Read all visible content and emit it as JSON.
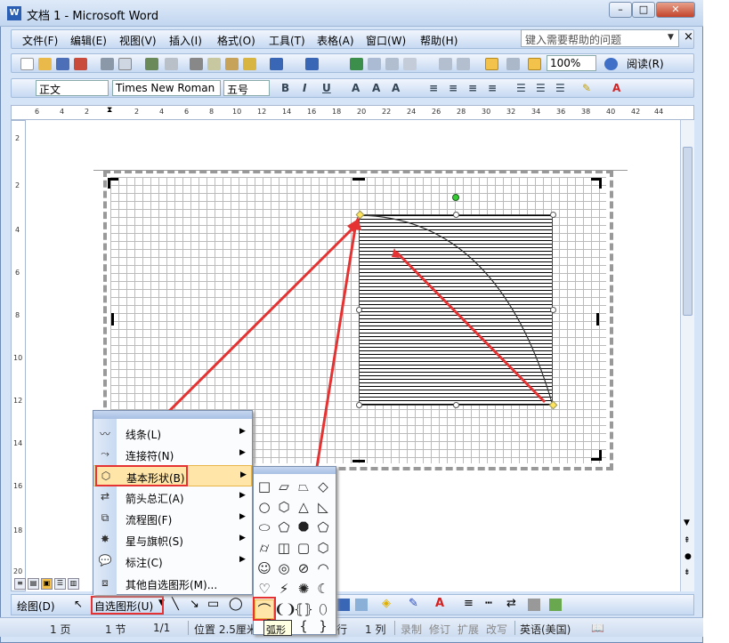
{
  "window": {
    "title": "文档 1 - Microsoft Word",
    "min_label": "–",
    "max_label": "□",
    "close_label": "✕",
    "app_icon": "W"
  },
  "menu": {
    "items": [
      "文件(F)",
      "编辑(E)",
      "视图(V)",
      "插入(I)",
      "格式(O)",
      "工具(T)",
      "表格(A)",
      "窗口(W)",
      "帮助(H)"
    ],
    "help_placeholder": "键入需要帮助的问题",
    "close_doc": "×"
  },
  "toolbar": {
    "zoom": "100%",
    "read": "阅读(R)"
  },
  "format": {
    "style": "正文",
    "font": "Times New Roman",
    "size": "五号"
  },
  "ruler": {
    "h_ticks": [
      "6",
      "4",
      "2",
      "2",
      "4",
      "6",
      "8",
      "10",
      "12",
      "14",
      "16",
      "18",
      "20",
      "22",
      "24",
      "26",
      "28",
      "30",
      "32",
      "34",
      "36",
      "38",
      "40",
      "42",
      "44"
    ],
    "v_ticks": [
      "2",
      "2",
      "4",
      "6",
      "8",
      "10",
      "12",
      "14",
      "16",
      "18",
      "20"
    ]
  },
  "autoshape_menu": {
    "items": [
      {
        "label": "线条(L)",
        "icon": "line-icon",
        "arrow": true
      },
      {
        "label": "连接符(N)",
        "icon": "connector-icon",
        "arrow": true
      },
      {
        "label": "基本形状(B)",
        "icon": "basic-shapes-icon",
        "arrow": true,
        "highlight": true
      },
      {
        "label": "箭头总汇(A)",
        "icon": "block-arrows-icon",
        "arrow": true
      },
      {
        "label": "流程图(F)",
        "icon": "flowchart-icon",
        "arrow": true
      },
      {
        "label": "星与旗帜(S)",
        "icon": "stars-banners-icon",
        "arrow": true
      },
      {
        "label": "标注(C)",
        "icon": "callouts-icon",
        "arrow": true
      },
      {
        "label": "其他自选图形(M)...",
        "icon": "more-autoshapes-icon",
        "arrow": false
      }
    ]
  },
  "basic_shapes": {
    "glyphs": [
      "□",
      "▱",
      "⏢",
      "◇",
      "○",
      "⬡",
      "△",
      "◺",
      "⬭",
      "⬠",
      "⯃",
      "⬠",
      "⌭",
      "◫",
      "▢",
      "⬡",
      "☺",
      "◎",
      "⊘",
      "◠",
      "♡",
      "⚡",
      "✺",
      "☾",
      "⌒",
      "❨❩",
      "⦃⦄",
      "⬯",
      "［",
      "❨",
      "{",
      "}"
    ],
    "tooltip": "弧形"
  },
  "drawbar": {
    "draw": "绘图(D)",
    "autoshapes": "自选图形(U)"
  },
  "status": {
    "page": "1 页",
    "section": "1 节",
    "pages": "1/1",
    "position": "位置 2.5厘米",
    "line": "行",
    "col": "1 列",
    "rec": "录制",
    "trk": "修订",
    "ext": "扩展",
    "ovr": "改写",
    "lang": "英语(美国)"
  },
  "colors": {
    "accent_red": "#e53333",
    "selection_yellow": "#ffe35c",
    "rotate_green": "#33cc33"
  }
}
